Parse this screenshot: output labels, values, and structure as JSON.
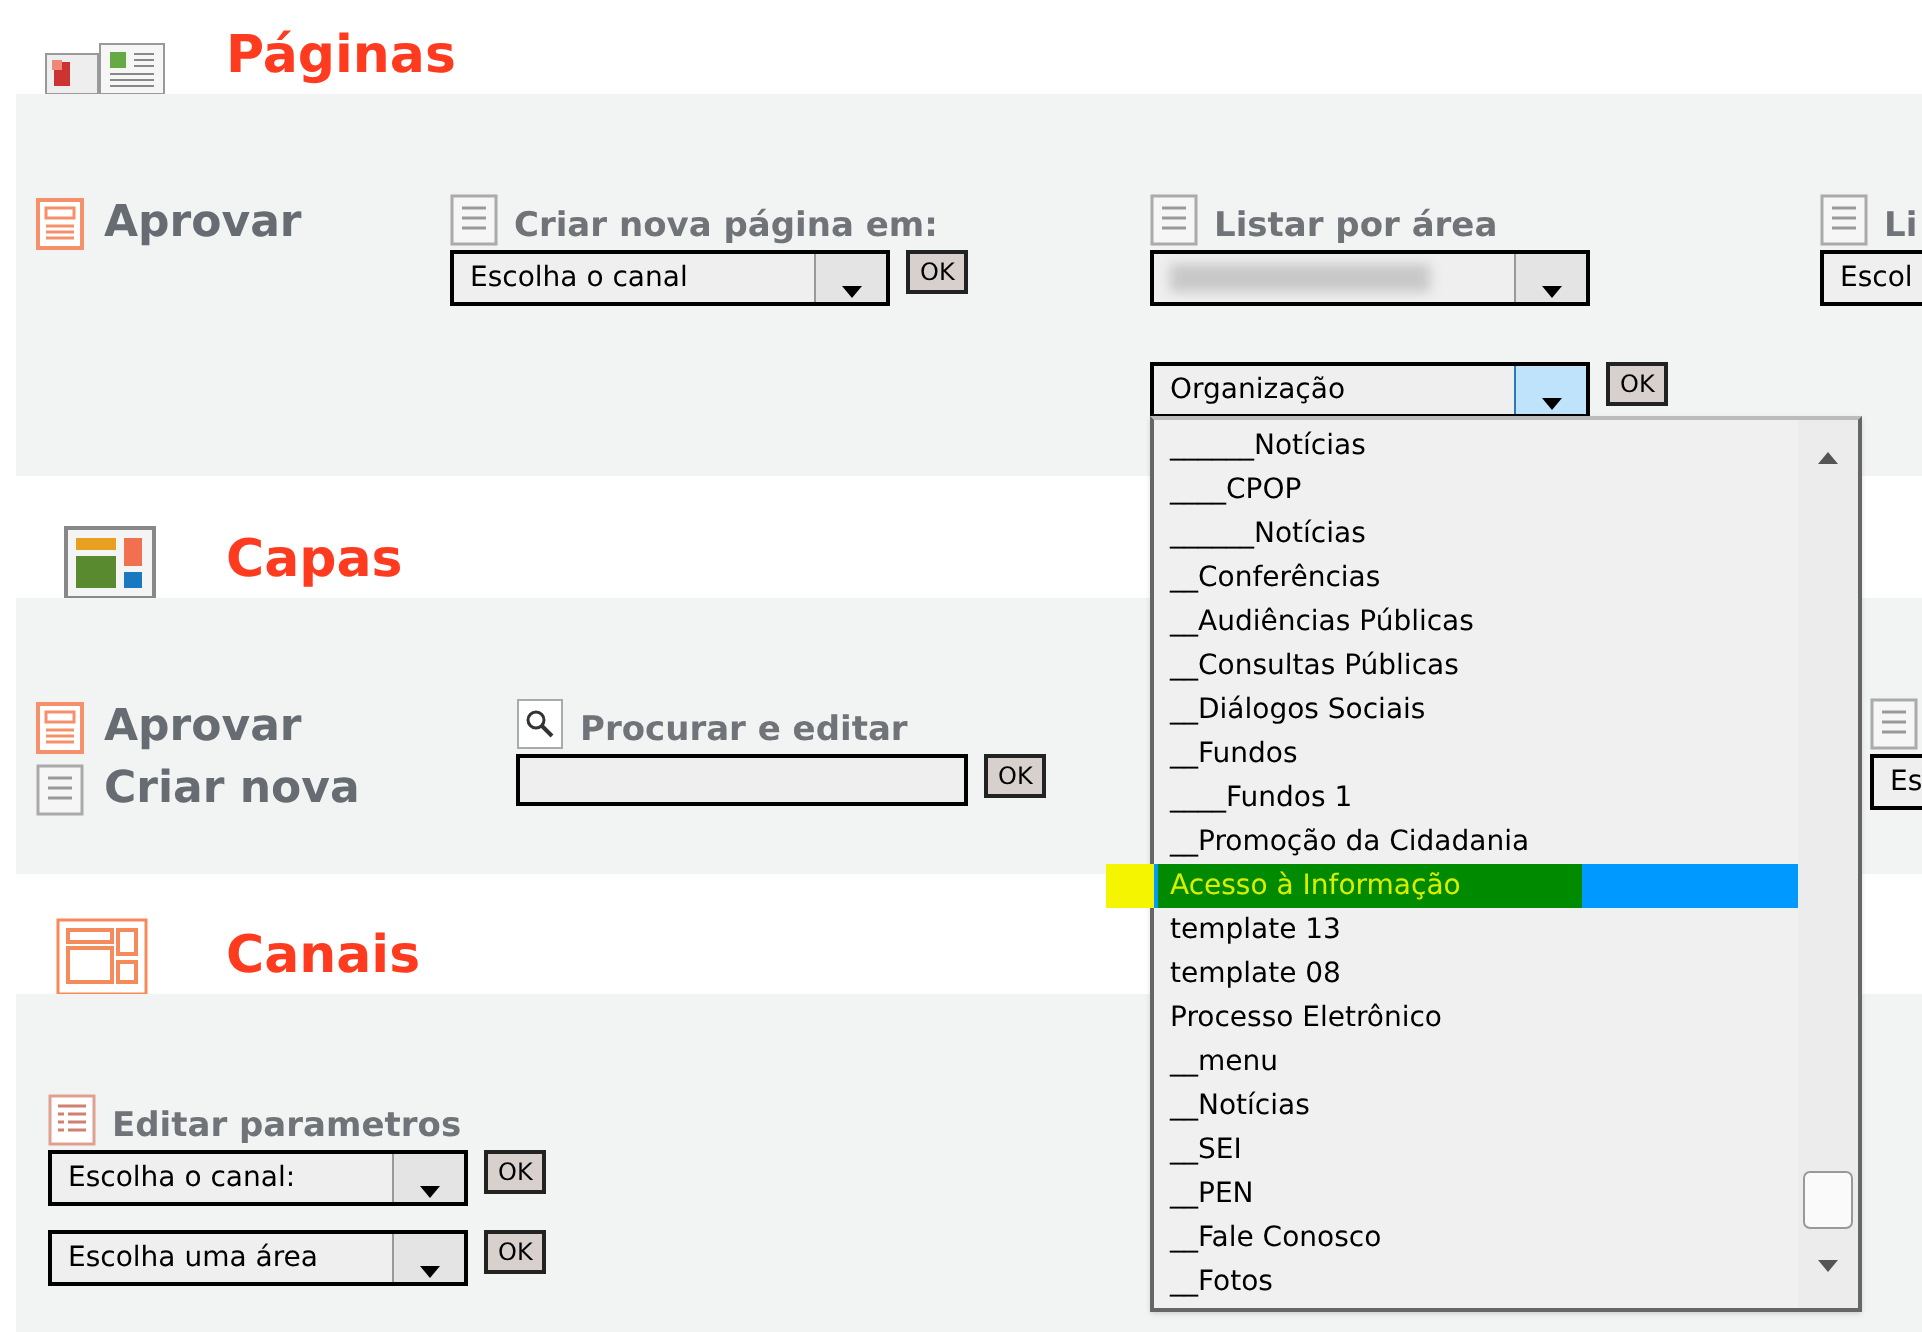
{
  "sections": [
    {
      "title": "Páginas",
      "columns": [
        {
          "kind": "links",
          "links": [
            {
              "label": "Aprovar",
              "kind": "approve"
            }
          ]
        },
        {
          "kind": "form",
          "label": "Criar nova página em:",
          "controls": [
            {
              "kind": "select",
              "value": "Escolha o canal",
              "button": "OK"
            }
          ]
        },
        {
          "kind": "form",
          "label": "Listar por área",
          "controls": [
            {
              "kind": "select",
              "obscured": true
            },
            {
              "kind": "select",
              "value": "Organização",
              "button": "OK",
              "focused": true
            }
          ]
        },
        {
          "kind": "form",
          "label": "Li",
          "controls": [
            {
              "kind": "select",
              "value": "Escol"
            }
          ]
        }
      ]
    },
    {
      "title": "Capas",
      "columns": [
        {
          "kind": "links",
          "links": [
            {
              "label": "Aprovar",
              "kind": "approve"
            },
            {
              "label": "Criar nova",
              "kind": "create"
            }
          ]
        },
        {
          "kind": "search",
          "label": "Procurar e editar",
          "controls": [
            {
              "kind": "text",
              "button": "OK"
            }
          ]
        },
        {
          "kind": "form",
          "controls": [
            {
              "kind": "select",
              "value": "Es"
            }
          ]
        }
      ]
    },
    {
      "title": "Canais",
      "columns": [
        {
          "kind": "settings",
          "label": "Editar parametros",
          "controls": [
            {
              "kind": "select",
              "value": "Escolha o canal:",
              "button": "OK"
            },
            {
              "kind": "select",
              "value": "Escolha uma área",
              "button": "OK"
            }
          ]
        }
      ]
    }
  ],
  "open_list": {
    "items": [
      {
        "label": "______Notícias",
        "selected": false,
        "annotated": false
      },
      {
        "label": "____CPOP",
        "selected": false,
        "annotated": false
      },
      {
        "label": "______Notícias",
        "selected": false,
        "annotated": false
      },
      {
        "label": "__Conferências",
        "selected": false,
        "annotated": false
      },
      {
        "label": "__Audiências Públicas",
        "selected": false,
        "annotated": false
      },
      {
        "label": "__Consultas Públicas",
        "selected": false,
        "annotated": false
      },
      {
        "label": "__Diálogos Sociais",
        "selected": false,
        "annotated": false
      },
      {
        "label": "__Fundos",
        "selected": false,
        "annotated": false
      },
      {
        "label": "____Fundos 1",
        "selected": false,
        "annotated": false
      },
      {
        "label": "__Promoção da Cidadania",
        "selected": false,
        "annotated": false
      },
      {
        "label": "Acesso à Informação",
        "selected": true,
        "annotated": true
      },
      {
        "label": "template 13",
        "selected": false,
        "annotated": false
      },
      {
        "label": "template 08",
        "selected": false,
        "annotated": false
      },
      {
        "label": "Processo Eletrônico",
        "selected": false,
        "annotated": false
      },
      {
        "label": "__menu",
        "selected": false,
        "annotated": false
      },
      {
        "label": "__Notícias",
        "selected": false,
        "annotated": false
      },
      {
        "label": "__SEI",
        "selected": false,
        "annotated": false
      },
      {
        "label": "__PEN",
        "selected": false,
        "annotated": false
      },
      {
        "label": "__Fale Conosco",
        "selected": false,
        "annotated": false
      },
      {
        "label": "__Fotos",
        "selected": false,
        "annotated": false
      }
    ]
  }
}
